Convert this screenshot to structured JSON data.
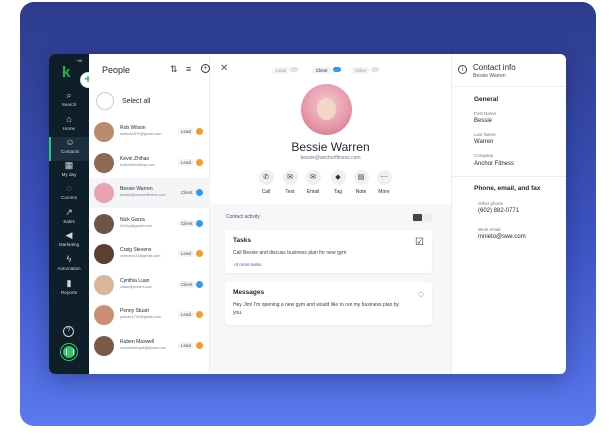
{
  "rail": {
    "nav": [
      {
        "label": "Search",
        "icon": "search-icon",
        "glyph": "⌕"
      },
      {
        "label": "Home",
        "icon": "home-icon",
        "glyph": "⌂"
      },
      {
        "label": "Contacts",
        "icon": "contacts-icon",
        "glyph": "☺"
      },
      {
        "label": "My day",
        "icon": "calendar-icon",
        "glyph": "▦"
      },
      {
        "label": "Comms",
        "icon": "chat-icon",
        "glyph": "◌"
      },
      {
        "label": "Sales",
        "icon": "sales-icon",
        "glyph": "↗"
      },
      {
        "label": "Marketing",
        "icon": "megaphone-icon",
        "glyph": "◀"
      },
      {
        "label": "Automation",
        "icon": "lightning-icon",
        "glyph": "ϟ"
      },
      {
        "label": "Reports",
        "icon": "reports-icon",
        "glyph": "▮"
      }
    ]
  },
  "people": {
    "title": "People",
    "select_all": "Select all",
    "rows": [
      {
        "name": "Rob Wilson",
        "email": "rwilson1970@gmail.com",
        "tag": "Lead",
        "dot": "#f39c2a",
        "avatar": "#b98a6b"
      },
      {
        "name": "Kevin Zhihao",
        "email": "kz@mtrxchitcup.com",
        "tag": "Lead",
        "dot": "#f39c2a",
        "avatar": "#8e6a55"
      },
      {
        "name": "Bessie Warren",
        "email": "bessie@anchorfitness.com",
        "tag": "Client",
        "dot": "#2e9bf0",
        "avatar": "#e8a3b2"
      },
      {
        "name": "Nick Garza",
        "email": "NGtxp@gmail.com",
        "tag": "Client",
        "dot": "#2e9bf0",
        "avatar": "#6d5648"
      },
      {
        "name": "Craig Stevens",
        "email": "cstevens33@gmail.com",
        "tag": "Lead",
        "dot": "#f39c2a",
        "avatar": "#5c3f2e"
      },
      {
        "name": "Cynthia Luan",
        "email": "cluan@modrd.com",
        "tag": "Client",
        "dot": "#2e9bf0",
        "avatar": "#d9b59a"
      },
      {
        "name": "Penny Stuart",
        "email": "pstuart1700@gmail.com",
        "tag": "Lead",
        "dot": "#f39c2a",
        "avatar": "#c98f72"
      },
      {
        "name": "Ruben Maxwell",
        "email": "maxwellsimple@gmail.com",
        "tag": "Lead",
        "dot": "#f39c2a",
        "avatar": "#7a5a47"
      }
    ]
  },
  "main": {
    "stages": [
      "Lead",
      "Client",
      "Other"
    ],
    "contact_name": "Bessie Warren",
    "contact_email": "bessie@anchorfitness.com",
    "actions": [
      {
        "label": "Call",
        "icon": "phone-icon",
        "glyph": "✆"
      },
      {
        "label": "Text",
        "icon": "text-icon",
        "glyph": "✉"
      },
      {
        "label": "Email",
        "icon": "email-icon",
        "glyph": "✉"
      },
      {
        "label": "Tag",
        "icon": "tag-icon",
        "glyph": "◆"
      },
      {
        "label": "Note",
        "icon": "note-icon",
        "glyph": "▤"
      },
      {
        "label": "More",
        "icon": "more-icon",
        "glyph": "⋯"
      }
    ],
    "activity_label": "Contact activity",
    "tasks": {
      "title": "Tasks",
      "body": "Call Bessie and discuss business plan for new gym",
      "link": "+3 more tasks"
    },
    "messages": {
      "title": "Messages",
      "body": "Hey Jim! I'm opening a new gym and would like to run my business plan by you."
    }
  },
  "info": {
    "title": "Contact info",
    "subtitle": "Bessie Warren",
    "general": "General",
    "first_name_label": "First Name",
    "first_name": "Bessie",
    "last_name_label": "Last Name",
    "last_name": "Warren",
    "company_label": "Company",
    "company": "Anchor Fitness",
    "phone_section": "Phone, email, and fax",
    "other_phone_label": "Other phone",
    "other_phone": "(602) 882-0771",
    "work_email_label": "Work email",
    "work_email": "mnieto@swe.com"
  }
}
